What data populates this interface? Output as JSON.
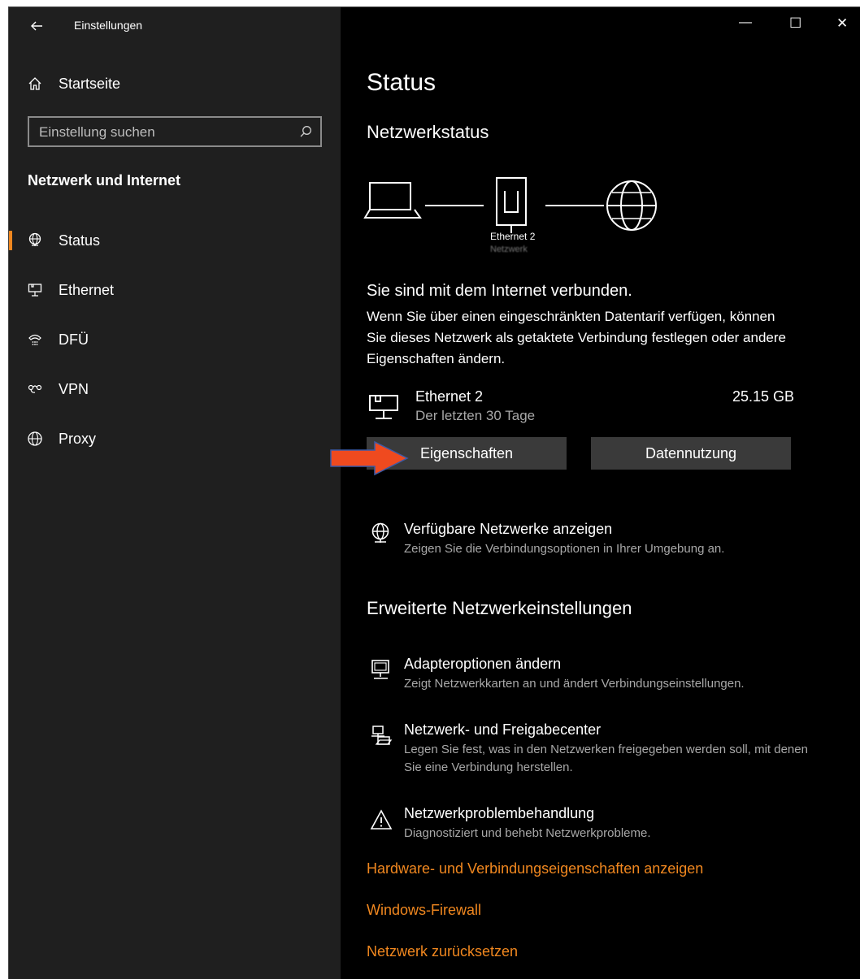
{
  "window": {
    "title": "Einstellungen",
    "controls": {
      "minimize": "—",
      "maximize": "☐",
      "close": "✕"
    }
  },
  "sidebar": {
    "home_label": "Startseite",
    "search_placeholder": "Einstellung suchen",
    "section_title": "Netzwerk und Internet",
    "items": [
      {
        "label": "Status",
        "icon": "globe-status-icon",
        "active": true
      },
      {
        "label": "Ethernet",
        "icon": "ethernet-icon",
        "active": false
      },
      {
        "label": "DFÜ",
        "icon": "dialup-icon",
        "active": false
      },
      {
        "label": "VPN",
        "icon": "vpn-icon",
        "active": false
      },
      {
        "label": "Proxy",
        "icon": "globe-icon",
        "active": false
      }
    ]
  },
  "main": {
    "page_title": "Status",
    "network_status_title": "Netzwerkstatus",
    "diagram": {
      "adapter_label": "Ethernet 2",
      "adapter_sublabel": "Netzwerk"
    },
    "connected_heading": "Sie sind mit dem Internet verbunden.",
    "connected_text": "Wenn Sie über einen eingeschränkten Datentarif verfügen, können Sie dieses Netzwerk als getaktete Verbindung festlegen oder andere Eigenschaften ändern.",
    "adapter": {
      "name": "Ethernet 2",
      "period": "Der letzten 30 Tage",
      "usage": "25.15 GB"
    },
    "buttons": {
      "properties": "Eigenschaften",
      "data_usage": "Datennutzung"
    },
    "available_networks": {
      "title": "Verfügbare Netzwerke anzeigen",
      "desc": "Zeigen Sie die Verbindungsoptionen in Ihrer Umgebung an."
    },
    "advanced_title": "Erweiterte Netzwerkeinstellungen",
    "advanced_items": [
      {
        "title": "Adapteroptionen ändern",
        "desc": "Zeigt Netzwerkkarten an und ändert Verbindungseinstellungen.",
        "icon": "monitor-adapter-icon"
      },
      {
        "title": "Netzwerk- und Freigabecenter",
        "desc": "Legen Sie fest, was in den Netzwerken freigegeben werden soll, mit denen Sie eine Verbindung herstellen.",
        "icon": "network-sharing-icon"
      },
      {
        "title": "Netzwerkproblembehandlung",
        "desc": "Diagnostiziert und behebt Netzwerkprobleme.",
        "icon": "warning-icon"
      }
    ],
    "links": [
      "Hardware- und Verbindungseigenschaften anzeigen",
      "Windows-Firewall",
      "Netzwerk zurücksetzen"
    ]
  },
  "colors": {
    "accent": "#f0871f",
    "annotation_arrow": "#ef4a1f"
  }
}
